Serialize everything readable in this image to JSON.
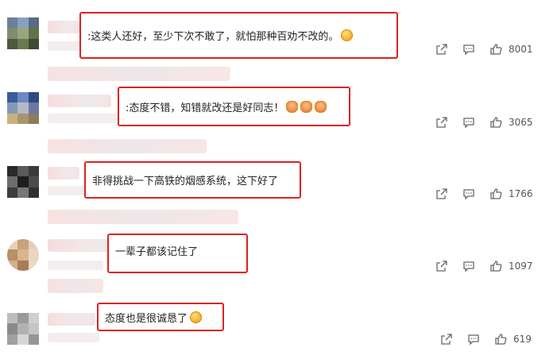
{
  "comments": [
    {
      "text": ":这类人还好，至少下次不敢了，就怕那种百劝不改的。",
      "emoji": "laughing-emoji",
      "likes": "8001"
    },
    {
      "text": ":态度不错，知错就改还是好同志！",
      "emoji": "applause-emoji",
      "likes": "3065"
    },
    {
      "text": "非得挑战一下高铁的烟感系统，这下好了",
      "emoji": "",
      "likes": "1766"
    },
    {
      "text": "一辈子都该记住了",
      "emoji": "",
      "likes": "1097"
    },
    {
      "text": "态度也是很诚恳了",
      "emoji": "laughing-emoji",
      "likes": "619"
    }
  ],
  "colors": {
    "highlight_border": "#dd2222",
    "icon": "#666666"
  },
  "icons": [
    "share-icon",
    "comment-icon",
    "like-icon"
  ]
}
